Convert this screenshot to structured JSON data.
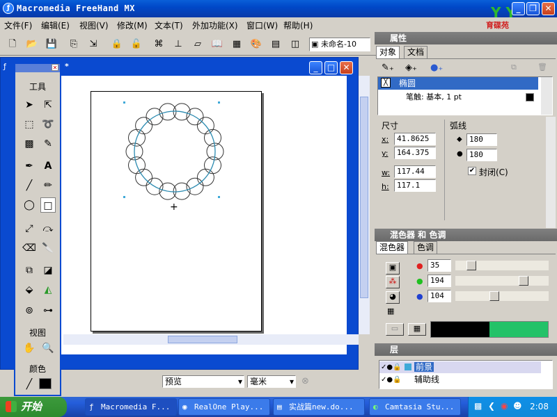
{
  "window": {
    "title": "Macromedia FreeHand MX",
    "logo_text": "育碟苑",
    "doc_title_suffix": "*"
  },
  "menu": [
    "文件(F)",
    "编辑(E)",
    "视图(V)",
    "修改(M)",
    "文本(T)",
    "外加功能(X)",
    "窗口(W)",
    "帮助(H)"
  ],
  "toolbar": {
    "doc_name": "未命名-10"
  },
  "tools": {
    "title": "工具",
    "view_title": "视图",
    "color_title": "颜色"
  },
  "status": {
    "preview": "预览",
    "units": "毫米"
  },
  "properties": {
    "title": "属性",
    "tab_object": "对象",
    "tab_document": "文档",
    "item_name": "椭圆",
    "stroke_label": "笔触: 基本, 1 pt",
    "size_label": "尺寸",
    "arc_label": "弧线",
    "x_label": "x:",
    "x": "41.8625",
    "y_label": "y:",
    "y": "164.375",
    "w_label": "w:",
    "w": "117.44",
    "h_label": "h:",
    "h": "117.1",
    "arc1": "180",
    "arc2": "180",
    "closed_label": "封闭(C)",
    "closed": true
  },
  "mixer": {
    "title": "混色器 和 色调",
    "tab_mixer": "混色器",
    "tab_tint": "色调",
    "r": "35",
    "g": "194",
    "b": "104",
    "r_frac": 0.137,
    "g_frac": 0.761,
    "b_frac": 0.408,
    "swatch_old": "#000000",
    "swatch_new": "#23c268"
  },
  "layers": {
    "title": "层",
    "items": [
      "前景",
      "辅助线"
    ]
  },
  "taskbar": {
    "start": "开始",
    "tasks": [
      "Macromedia F...",
      "RealOne Play...",
      "实战篇new.do...",
      "Camtasia Stu..."
    ],
    "time": "2:08"
  }
}
